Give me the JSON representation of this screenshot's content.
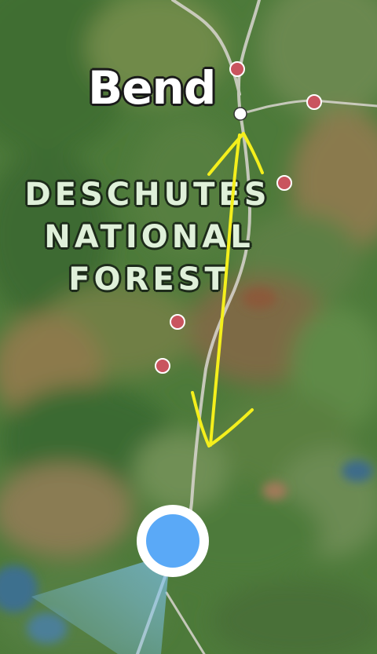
{
  "map": {
    "city_label": "Bend",
    "region_label_lines": [
      "DESCHUTES",
      "NATIONAL",
      "FOREST"
    ],
    "colors": {
      "terrain_base": "#4f7a3c",
      "road": "#d9d6d0",
      "poi_marker": "#c9545f",
      "city_dot": "#ffffff",
      "annotation": "#f4ef1c",
      "location_dot": "#5aa9f7",
      "heading_cone": "#7fc3ee"
    },
    "icons": {
      "poi": "poi-marker-icon",
      "city": "city-dot-icon",
      "current_location": "current-location-icon",
      "heading": "heading-cone-icon"
    }
  }
}
